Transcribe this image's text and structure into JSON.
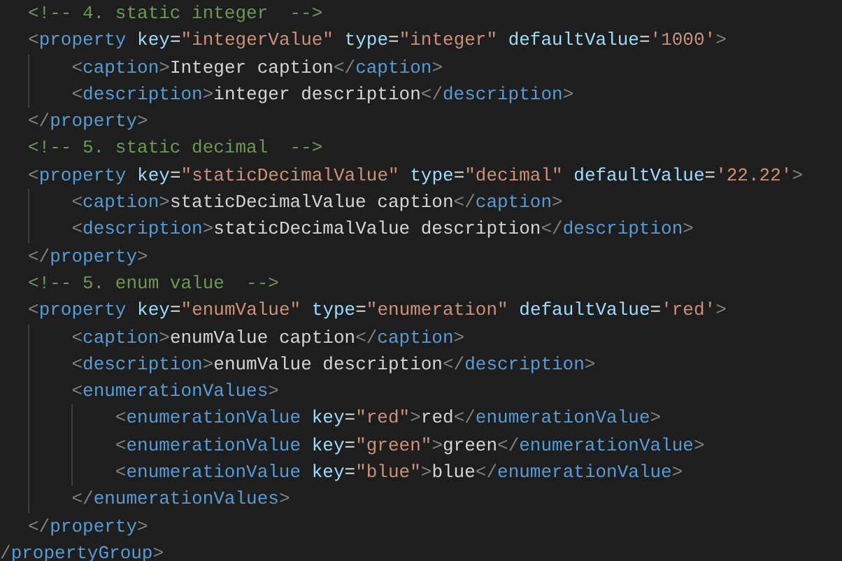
{
  "editor": {
    "lines": [
      {
        "tokens": [
          {
            "kind": "comment",
            "text": "<!-- 4. static integer  -->"
          }
        ]
      },
      {
        "tokens": [
          {
            "kind": "bracket",
            "text": "<"
          },
          {
            "kind": "tag",
            "text": "property"
          },
          {
            "kind": "attr",
            "text": " key"
          },
          {
            "kind": "eq",
            "text": "="
          },
          {
            "kind": "string",
            "text": "\"integerValue\""
          },
          {
            "kind": "attr",
            "text": " type"
          },
          {
            "kind": "eq",
            "text": "="
          },
          {
            "kind": "string",
            "text": "\"integer\""
          },
          {
            "kind": "attr",
            "text": " defaultValue"
          },
          {
            "kind": "eq",
            "text": "="
          },
          {
            "kind": "string",
            "text": "'1000'"
          },
          {
            "kind": "bracket",
            "text": ">"
          }
        ],
        "children": [
          {
            "tokens": [
              {
                "kind": "bracket",
                "text": "<"
              },
              {
                "kind": "tag",
                "text": "caption"
              },
              {
                "kind": "bracket",
                "text": ">"
              },
              {
                "kind": "text",
                "text": "Integer caption"
              },
              {
                "kind": "bracket",
                "text": "</"
              },
              {
                "kind": "tag",
                "text": "caption"
              },
              {
                "kind": "bracket",
                "text": ">"
              }
            ]
          },
          {
            "tokens": [
              {
                "kind": "bracket",
                "text": "<"
              },
              {
                "kind": "tag",
                "text": "description"
              },
              {
                "kind": "bracket",
                "text": ">"
              },
              {
                "kind": "text",
                "text": "integer description"
              },
              {
                "kind": "bracket",
                "text": "</"
              },
              {
                "kind": "tag",
                "text": "description"
              },
              {
                "kind": "bracket",
                "text": ">"
              }
            ]
          }
        ]
      },
      {
        "tokens": [
          {
            "kind": "bracket",
            "text": "</"
          },
          {
            "kind": "tag",
            "text": "property"
          },
          {
            "kind": "bracket",
            "text": ">"
          }
        ]
      },
      {
        "tokens": [
          {
            "kind": "comment",
            "text": "<!-- 5. static decimal  -->"
          }
        ]
      },
      {
        "tokens": [
          {
            "kind": "bracket",
            "text": "<"
          },
          {
            "kind": "tag",
            "text": "property"
          },
          {
            "kind": "attr",
            "text": " key"
          },
          {
            "kind": "eq",
            "text": "="
          },
          {
            "kind": "string",
            "text": "\"staticDecimalValue\""
          },
          {
            "kind": "attr",
            "text": " type"
          },
          {
            "kind": "eq",
            "text": "="
          },
          {
            "kind": "string",
            "text": "\"decimal\""
          },
          {
            "kind": "attr",
            "text": " defaultValue"
          },
          {
            "kind": "eq",
            "text": "="
          },
          {
            "kind": "string",
            "text": "'22.22'"
          },
          {
            "kind": "bracket",
            "text": ">"
          }
        ],
        "children": [
          {
            "tokens": [
              {
                "kind": "bracket",
                "text": "<"
              },
              {
                "kind": "tag",
                "text": "caption"
              },
              {
                "kind": "bracket",
                "text": ">"
              },
              {
                "kind": "text",
                "text": "staticDecimalValue caption"
              },
              {
                "kind": "bracket",
                "text": "</"
              },
              {
                "kind": "tag",
                "text": "caption"
              },
              {
                "kind": "bracket",
                "text": ">"
              }
            ]
          },
          {
            "tokens": [
              {
                "kind": "bracket",
                "text": "<"
              },
              {
                "kind": "tag",
                "text": "description"
              },
              {
                "kind": "bracket",
                "text": ">"
              },
              {
                "kind": "text",
                "text": "staticDecimalValue description"
              },
              {
                "kind": "bracket",
                "text": "</"
              },
              {
                "kind": "tag",
                "text": "description"
              },
              {
                "kind": "bracket",
                "text": ">"
              }
            ]
          }
        ]
      },
      {
        "tokens": [
          {
            "kind": "bracket",
            "text": "</"
          },
          {
            "kind": "tag",
            "text": "property"
          },
          {
            "kind": "bracket",
            "text": ">"
          }
        ]
      },
      {
        "tokens": [
          {
            "kind": "comment",
            "text": "<!-- 5. enum value  -->"
          }
        ]
      },
      {
        "tokens": [
          {
            "kind": "bracket",
            "text": "<"
          },
          {
            "kind": "tag",
            "text": "property"
          },
          {
            "kind": "attr",
            "text": " key"
          },
          {
            "kind": "eq",
            "text": "="
          },
          {
            "kind": "string",
            "text": "\"enumValue\""
          },
          {
            "kind": "attr",
            "text": " type"
          },
          {
            "kind": "eq",
            "text": "="
          },
          {
            "kind": "string",
            "text": "\"enumeration\""
          },
          {
            "kind": "attr",
            "text": " defaultValue"
          },
          {
            "kind": "eq",
            "text": "="
          },
          {
            "kind": "string",
            "text": "'red'"
          },
          {
            "kind": "bracket",
            "text": ">"
          }
        ],
        "children": [
          {
            "tokens": [
              {
                "kind": "bracket",
                "text": "<"
              },
              {
                "kind": "tag",
                "text": "caption"
              },
              {
                "kind": "bracket",
                "text": ">"
              },
              {
                "kind": "text",
                "text": "enumValue caption"
              },
              {
                "kind": "bracket",
                "text": "</"
              },
              {
                "kind": "tag",
                "text": "caption"
              },
              {
                "kind": "bracket",
                "text": ">"
              }
            ]
          },
          {
            "tokens": [
              {
                "kind": "bracket",
                "text": "<"
              },
              {
                "kind": "tag",
                "text": "description"
              },
              {
                "kind": "bracket",
                "text": ">"
              },
              {
                "kind": "text",
                "text": "enumValue description"
              },
              {
                "kind": "bracket",
                "text": "</"
              },
              {
                "kind": "tag",
                "text": "description"
              },
              {
                "kind": "bracket",
                "text": ">"
              }
            ]
          },
          {
            "tokens": [
              {
                "kind": "bracket",
                "text": "<"
              },
              {
                "kind": "tag",
                "text": "enumerationValues"
              },
              {
                "kind": "bracket",
                "text": ">"
              }
            ],
            "children": [
              {
                "tokens": [
                  {
                    "kind": "bracket",
                    "text": "<"
                  },
                  {
                    "kind": "tag",
                    "text": "enumerationValue"
                  },
                  {
                    "kind": "attr",
                    "text": " key"
                  },
                  {
                    "kind": "eq",
                    "text": "="
                  },
                  {
                    "kind": "string",
                    "text": "\"red\""
                  },
                  {
                    "kind": "bracket",
                    "text": ">"
                  },
                  {
                    "kind": "text",
                    "text": "red"
                  },
                  {
                    "kind": "bracket",
                    "text": "</"
                  },
                  {
                    "kind": "tag",
                    "text": "enumerationValue"
                  },
                  {
                    "kind": "bracket",
                    "text": ">"
                  }
                ]
              },
              {
                "tokens": [
                  {
                    "kind": "bracket",
                    "text": "<"
                  },
                  {
                    "kind": "tag",
                    "text": "enumerationValue"
                  },
                  {
                    "kind": "attr",
                    "text": " key"
                  },
                  {
                    "kind": "eq",
                    "text": "="
                  },
                  {
                    "kind": "string",
                    "text": "\"green\""
                  },
                  {
                    "kind": "bracket",
                    "text": ">"
                  },
                  {
                    "kind": "text",
                    "text": "green"
                  },
                  {
                    "kind": "bracket",
                    "text": "</"
                  },
                  {
                    "kind": "tag",
                    "text": "enumerationValue"
                  },
                  {
                    "kind": "bracket",
                    "text": ">"
                  }
                ]
              },
              {
                "tokens": [
                  {
                    "kind": "bracket",
                    "text": "<"
                  },
                  {
                    "kind": "tag",
                    "text": "enumerationValue"
                  },
                  {
                    "kind": "attr",
                    "text": " key"
                  },
                  {
                    "kind": "eq",
                    "text": "="
                  },
                  {
                    "kind": "string",
                    "text": "\"blue\""
                  },
                  {
                    "kind": "bracket",
                    "text": ">"
                  },
                  {
                    "kind": "text",
                    "text": "blue"
                  },
                  {
                    "kind": "bracket",
                    "text": "</"
                  },
                  {
                    "kind": "tag",
                    "text": "enumerationValue"
                  },
                  {
                    "kind": "bracket",
                    "text": ">"
                  }
                ]
              }
            ]
          },
          {
            "tokens": [
              {
                "kind": "bracket",
                "text": "</"
              },
              {
                "kind": "tag",
                "text": "enumerationValues"
              },
              {
                "kind": "bracket",
                "text": ">"
              }
            ]
          }
        ]
      },
      {
        "tokens": [
          {
            "kind": "bracket",
            "text": "</"
          },
          {
            "kind": "tag",
            "text": "property"
          },
          {
            "kind": "bracket",
            "text": ">"
          }
        ]
      }
    ],
    "closing_line": {
      "tokens": [
        {
          "kind": "bracket",
          "text": "/"
        },
        {
          "kind": "tag",
          "text": "propertyGroup"
        },
        {
          "kind": "bracket",
          "text": ">"
        }
      ]
    }
  }
}
